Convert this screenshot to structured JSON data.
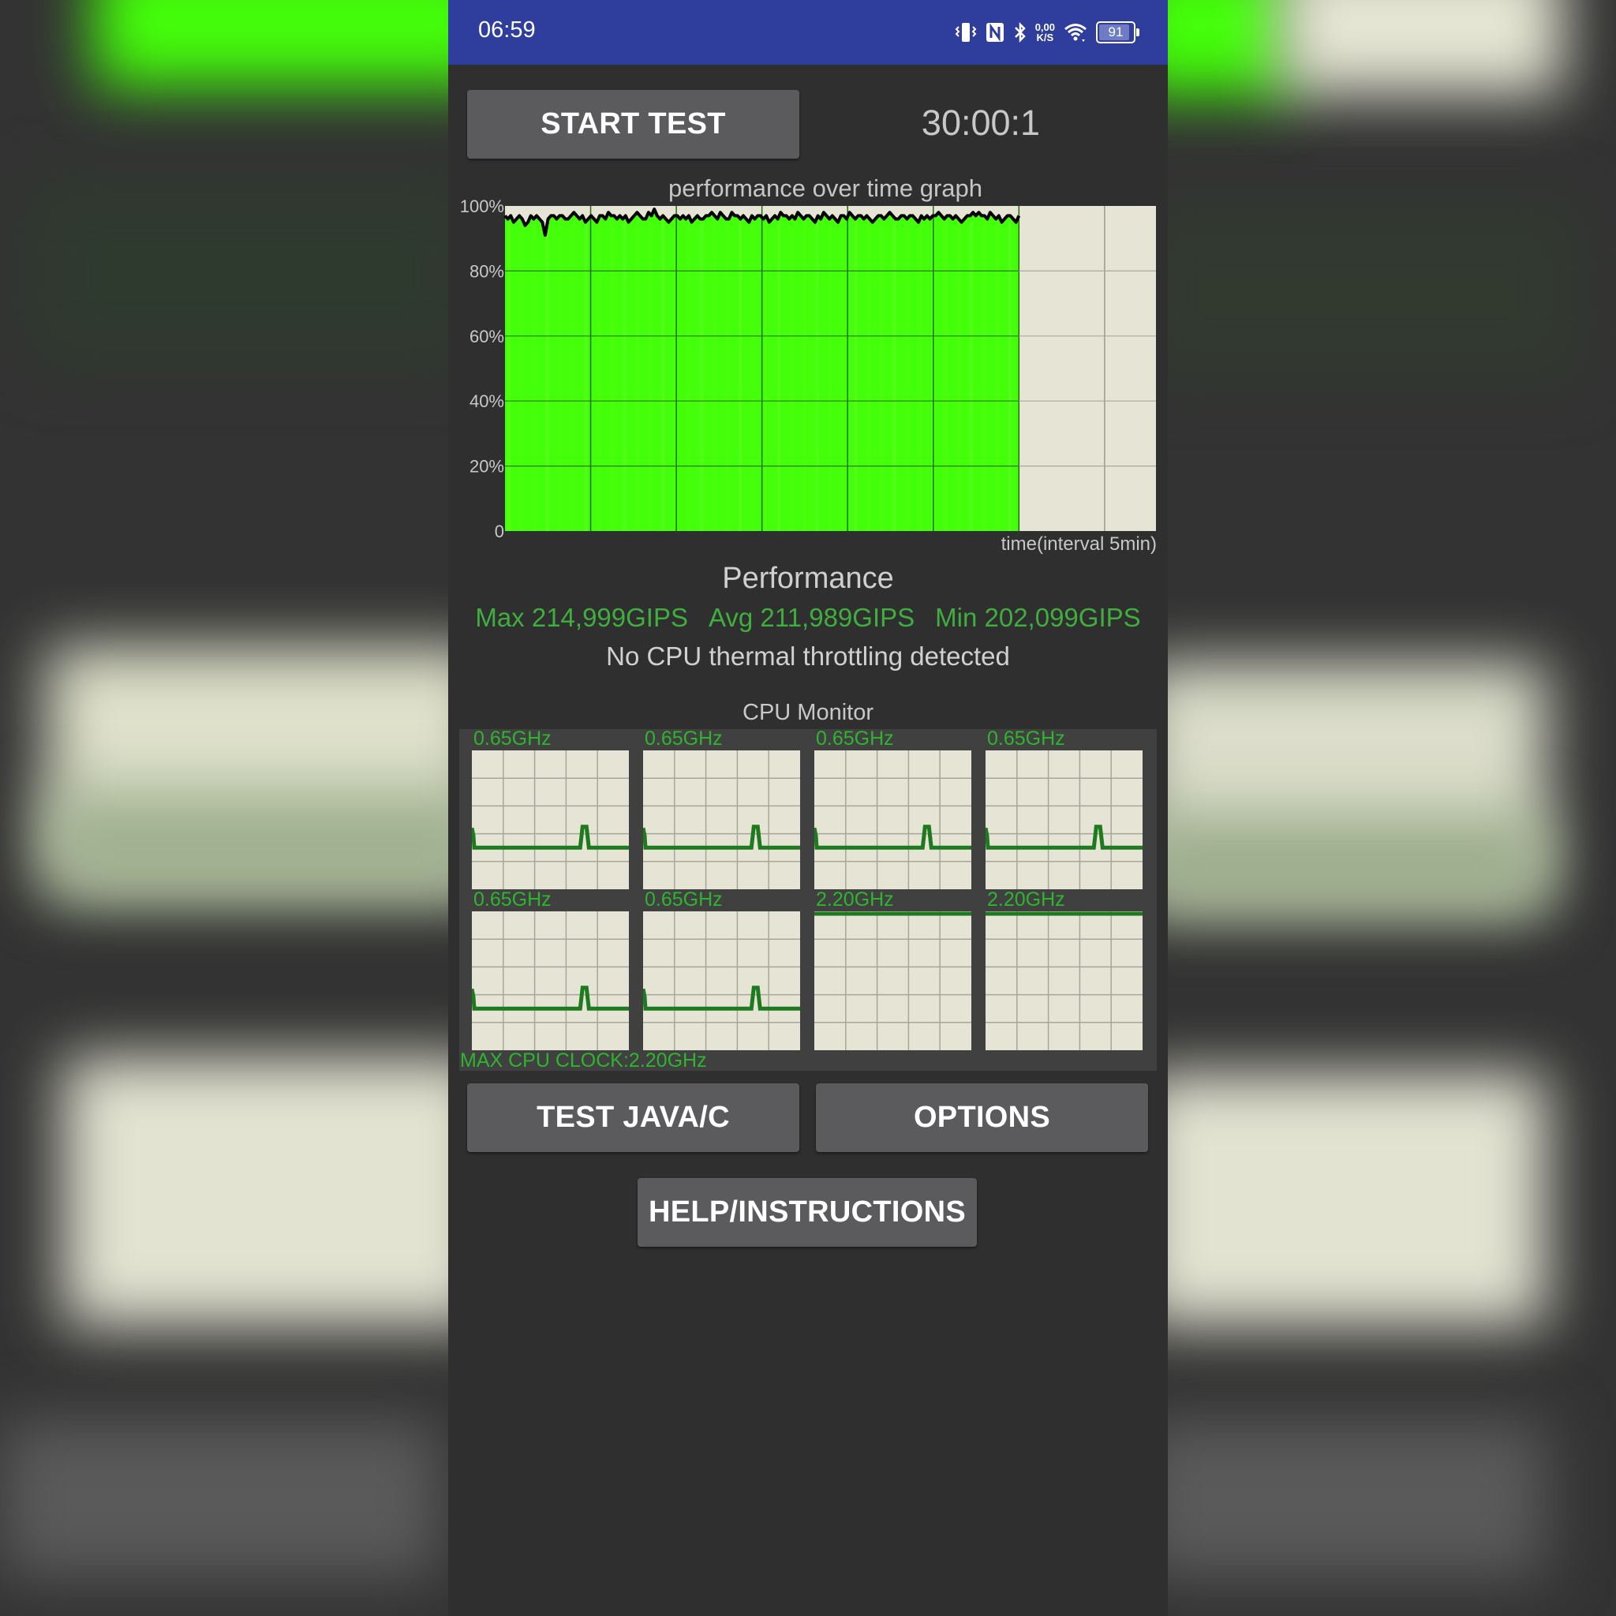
{
  "status_bar": {
    "time": "06:59",
    "icons": [
      "vibrate-icon",
      "nfc-icon",
      "bluetooth-icon",
      "network-speed-icon",
      "wifi-icon",
      "battery-icon"
    ],
    "network_speed_value": "0,00",
    "network_speed_unit": "K/S",
    "battery_level": "91",
    "battery_percent": 91,
    "background_color": "#2f3d9c"
  },
  "toolbar": {
    "start_test_label": "START TEST",
    "timer": "30:00:1"
  },
  "chart_data": {
    "type": "area",
    "title": "performance over time graph",
    "xlabel": "time(interval 5min)",
    "ylabel": "",
    "yticks": [
      "0",
      "20%",
      "40%",
      "60%",
      "80%",
      "100%"
    ],
    "ylim": [
      0,
      100
    ],
    "x_unit": "minutes",
    "xlim": [
      0,
      38
    ],
    "x_grid_interval": 5,
    "test_duration_min": 30,
    "fill_color": "#44ff0a",
    "line_color": "#000000",
    "unfilled_color": "#e6e4d4",
    "grid": true,
    "series": [
      {
        "name": "performance",
        "values": [
          97,
          96,
          97,
          95,
          96,
          97,
          96,
          94,
          95,
          97,
          96,
          97,
          96,
          95,
          91,
          96,
          97,
          97,
          96,
          97,
          97,
          96,
          96,
          97,
          98,
          97,
          96,
          97,
          95,
          96,
          97,
          96,
          95,
          97,
          97,
          96,
          98,
          97,
          97,
          96,
          97,
          96,
          97,
          95,
          96,
          97,
          98,
          97,
          96,
          96,
          98,
          97,
          99,
          97,
          96,
          97,
          96,
          95,
          96,
          97,
          97,
          96,
          97,
          96,
          97,
          95,
          96,
          97,
          96,
          96,
          97,
          97,
          98,
          97,
          96,
          98,
          97,
          96,
          96,
          98,
          97,
          97,
          96,
          97,
          96,
          95,
          97,
          96,
          97,
          97,
          96,
          97,
          95,
          96,
          97,
          96,
          98,
          97,
          97,
          96,
          97,
          96,
          98,
          97,
          96,
          97,
          97,
          96,
          95,
          97,
          96,
          98,
          97,
          96,
          97,
          96,
          95,
          97,
          97,
          96,
          98,
          97,
          96,
          97,
          97,
          96,
          97,
          96,
          95,
          96,
          97,
          97,
          96,
          97,
          98,
          97,
          96,
          96,
          97,
          97,
          96,
          97,
          97,
          96,
          95,
          97,
          96,
          97,
          96,
          97,
          97,
          98,
          97,
          96,
          97,
          97,
          96,
          97,
          96,
          95,
          96,
          97,
          97,
          98,
          97,
          98,
          97,
          97,
          96,
          98,
          97,
          96,
          97,
          95,
          96,
          97,
          97,
          96,
          95,
          97
        ]
      }
    ]
  },
  "performance": {
    "title": "Performance",
    "max": "Max 214,999GIPS",
    "avg": "Avg 211,989GIPS",
    "min": "Min 202,099GIPS",
    "throttling_message": "No CPU thermal throttling detected",
    "stats_color": "#3fae3f"
  },
  "cpu_monitor": {
    "title": "CPU Monitor",
    "max_clock_label": "MAX CPU CLOCK:2.20GHz",
    "cores": [
      {
        "freq": "0.65GHz",
        "level": 0.3
      },
      {
        "freq": "0.65GHz",
        "level": 0.3
      },
      {
        "freq": "0.65GHz",
        "level": 0.3
      },
      {
        "freq": "0.65GHz",
        "level": 0.3
      },
      {
        "freq": "0.65GHz",
        "level": 0.3
      },
      {
        "freq": "0.65GHz",
        "level": 0.3
      },
      {
        "freq": "2.20GHz",
        "level": 1.0
      },
      {
        "freq": "2.20GHz",
        "level": 1.0
      }
    ],
    "spike_level": 0.45,
    "line_color": "#1e7a1e",
    "label_color": "#2fb42f"
  },
  "buttons": {
    "test_java_c": "TEST JAVA/C",
    "options": "OPTIONS",
    "help": "HELP/INSTRUCTIONS"
  }
}
